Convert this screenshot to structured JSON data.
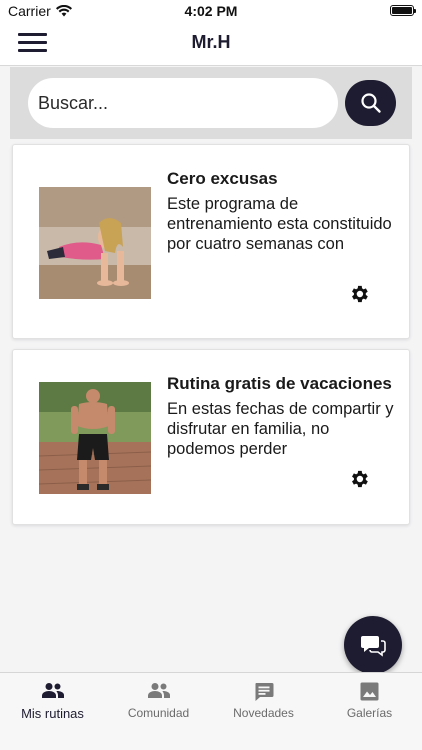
{
  "status_bar": {
    "carrier": "Carrier",
    "time": "4:02 PM",
    "icons": [
      "wifi-icon",
      "battery-icon"
    ]
  },
  "header": {
    "title": "Mr.H",
    "menu_icon": "hamburger-menu-icon"
  },
  "search": {
    "placeholder": "Buscar...",
    "value": "",
    "button_icon": "search-icon"
  },
  "cards": [
    {
      "title": "Cero excusas",
      "description": "Este programa de entrenamiento esta constituido por cuatro semanas con",
      "image": "woman-pushup-photo",
      "action_icon": "gear-icon"
    },
    {
      "title": "Rutina gratis de vacaciones",
      "description": "En estas fechas de compartir y disfrutar en familia, no podemos perder",
      "image": "muscular-man-photo",
      "action_icon": "gear-icon"
    }
  ],
  "fab": {
    "icon": "chat-bubbles-icon"
  },
  "tabs": [
    {
      "label": "Mis rutinas",
      "icon": "people-icon",
      "active": true
    },
    {
      "label": "Comunidad",
      "icon": "people-icon",
      "active": false
    },
    {
      "label": "Novedades",
      "icon": "message-icon",
      "active": false
    },
    {
      "label": "Galerías",
      "icon": "image-icon",
      "active": false
    }
  ],
  "colors": {
    "primary": "#1e1c30",
    "search_band": "#dcdcdc",
    "background": "#f4f4f5",
    "inactive_tab": "#6b6b6b"
  }
}
